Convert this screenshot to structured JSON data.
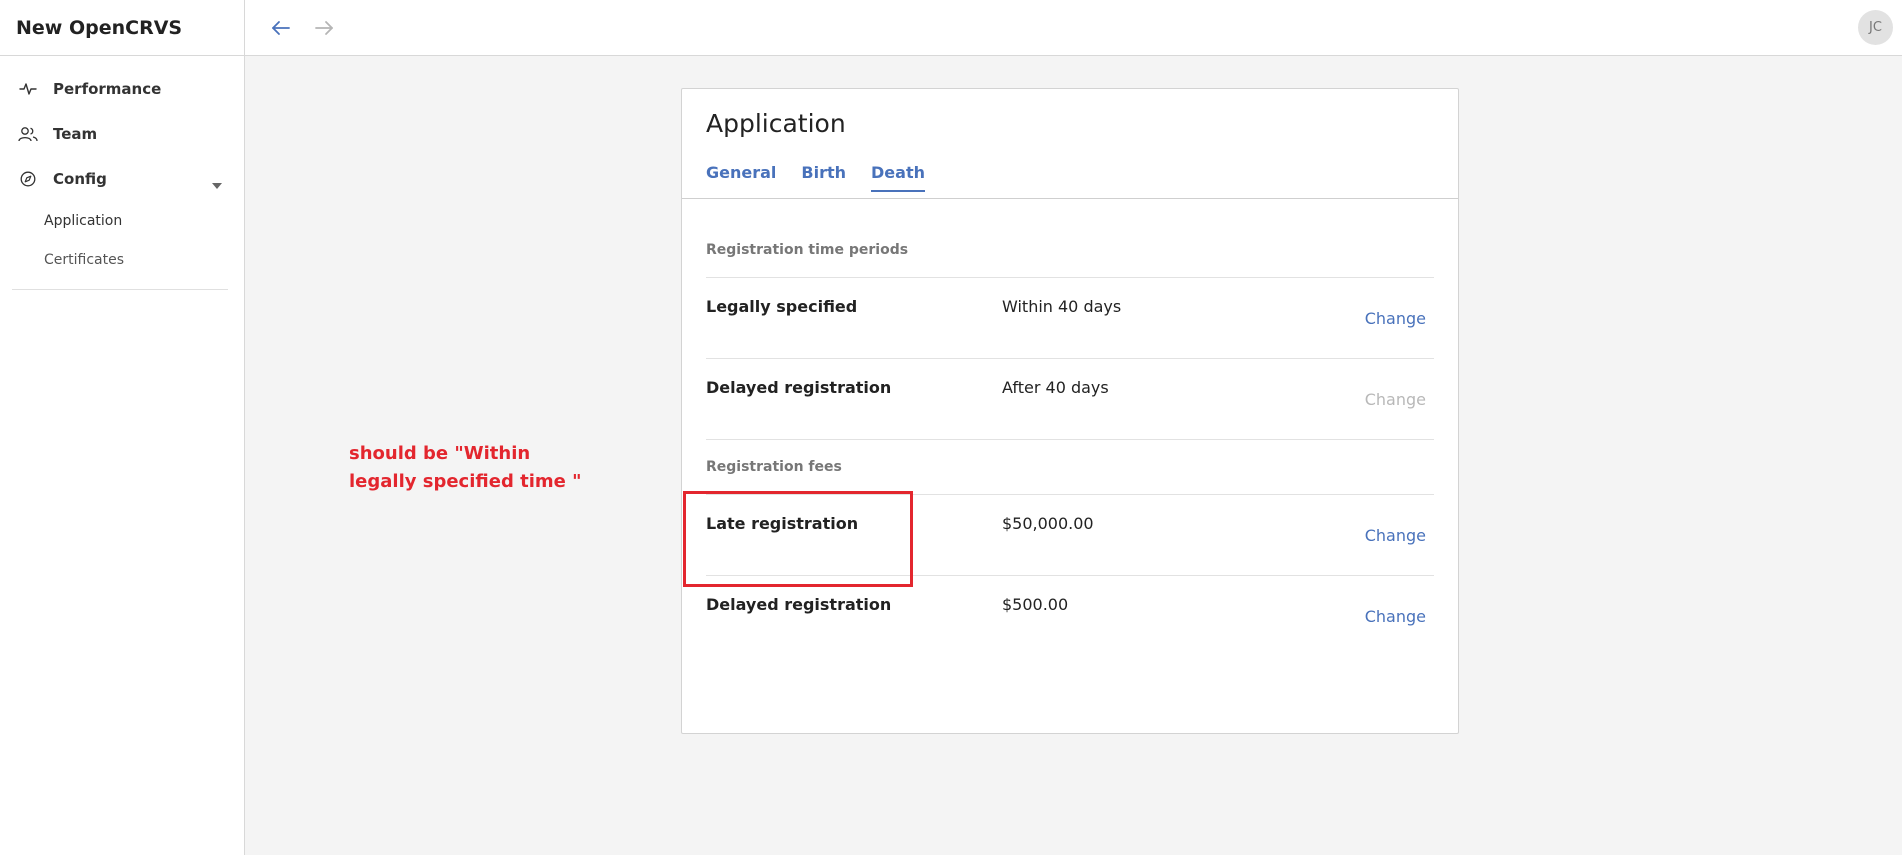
{
  "app": {
    "title": "New OpenCRVS"
  },
  "sidebar": {
    "items": [
      {
        "label": "Performance",
        "icon": "activity-icon"
      },
      {
        "label": "Team",
        "icon": "users-icon"
      },
      {
        "label": "Config",
        "icon": "compass-icon"
      }
    ],
    "config_subitems": [
      {
        "label": "Application"
      },
      {
        "label": "Certificates"
      }
    ]
  },
  "topbar": {
    "avatar_initials": "JC"
  },
  "card": {
    "title": "Application",
    "tabs": [
      {
        "label": "General",
        "active": false
      },
      {
        "label": "Birth",
        "active": false
      },
      {
        "label": "Death",
        "active": true
      }
    ],
    "sections": [
      {
        "label": "Registration time periods",
        "rows": [
          {
            "label": "Legally specified",
            "value": "Within 40 days",
            "action": "Change",
            "action_enabled": true
          },
          {
            "label": "Delayed registration",
            "value": "After 40 days",
            "action": "Change",
            "action_enabled": false
          }
        ]
      },
      {
        "label": "Registration fees",
        "rows": [
          {
            "label": "Late registration",
            "value": "$50,000.00",
            "action": "Change",
            "action_enabled": true
          },
          {
            "label": "Delayed registration",
            "value": "$500.00",
            "action": "Change",
            "action_enabled": true
          }
        ]
      }
    ]
  },
  "annotation": {
    "line1": "should be  \"Within",
    "line2": "legally specified time \""
  },
  "colors": {
    "accent": "#4972bb",
    "annotation": "#e3262e",
    "disabled": "#b8b8b8"
  }
}
